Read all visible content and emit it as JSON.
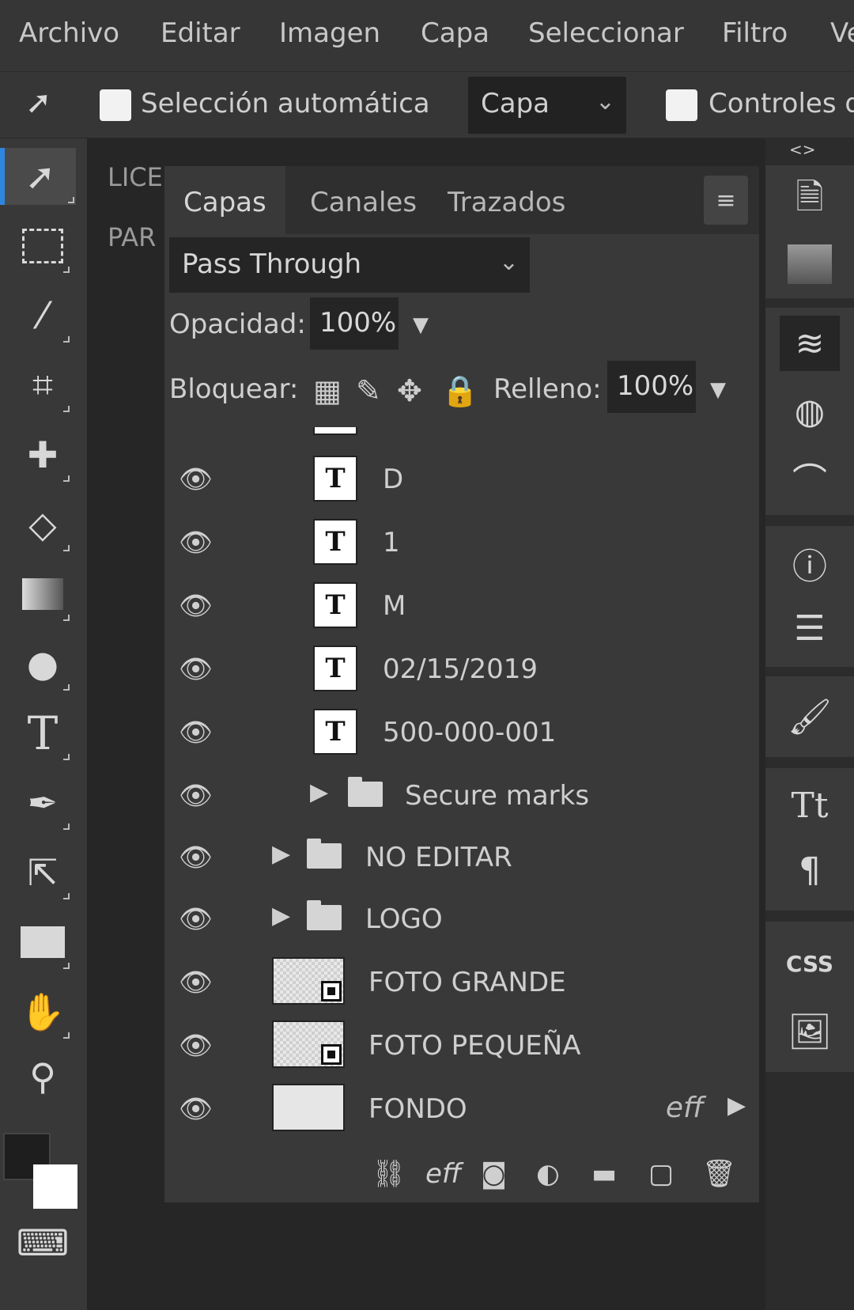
{
  "menu": {
    "items": [
      "Archivo",
      "Editar",
      "Imagen",
      "Capa",
      "Seleccionar",
      "Filtro",
      "Ve"
    ]
  },
  "options": {
    "auto_select_label": "Selección automática",
    "layer_select_value": "Capa",
    "controls_label": "Controles d"
  },
  "behind_panel": {
    "line1": "LICE",
    "line2": "PAR"
  },
  "layers_panel": {
    "tabs": [
      "Capas",
      "Canales",
      "Trazados"
    ],
    "blend_mode": "Pass Through",
    "opacity_label": "Opacidad:",
    "opacity_value": "100%",
    "lock_label": "Bloquear:",
    "fill_label": "Relleno:",
    "fill_value": "100%",
    "layers": [
      {
        "name": "D",
        "type": "text"
      },
      {
        "name": "1",
        "type": "text"
      },
      {
        "name": "M",
        "type": "text"
      },
      {
        "name": "02/15/2019",
        "type": "text"
      },
      {
        "name": "500-000-001",
        "type": "text"
      },
      {
        "name": "Secure marks",
        "type": "folder"
      },
      {
        "name": "NO EDITAR",
        "type": "folder"
      },
      {
        "name": "LOGO",
        "type": "folder"
      },
      {
        "name": "FOTO GRANDE",
        "type": "smart-object"
      },
      {
        "name": "FOTO PEQUEÑA",
        "type": "smart-object"
      },
      {
        "name": "FONDO",
        "type": "image",
        "effects": "eff"
      }
    ],
    "text_thumb_glyph": "T",
    "footer_fx": "eff"
  },
  "dock": {
    "collapse": "<>",
    "css_label": "CSS"
  },
  "colors": {
    "accent": "#2e86de",
    "foreground": "#1e1e1e",
    "background": "#ffffff"
  }
}
